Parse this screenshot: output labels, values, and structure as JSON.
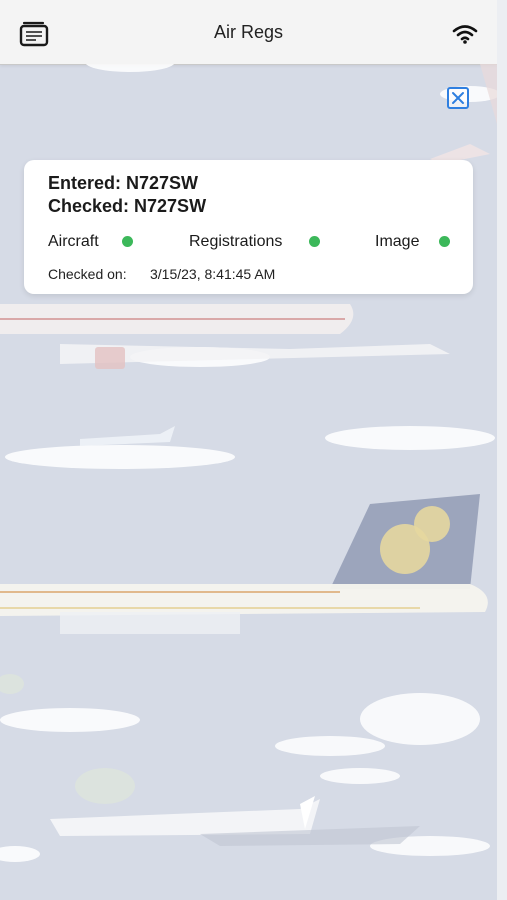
{
  "app": {
    "title": "Air Regs",
    "menu_icon": "document-stack-icon",
    "wifi_icon": "wifi-icon",
    "close_icon": "close-icon"
  },
  "result": {
    "entered": "Entered: N727SW",
    "checked": "Checked: N727SW",
    "statuses": [
      {
        "label": "Aircraft",
        "state": "green"
      },
      {
        "label": "Registrations",
        "state": "green"
      },
      {
        "label": "Image",
        "state": "green"
      }
    ],
    "checked_on_label": "Checked on:",
    "checked_on_value": "3/15/23, 8:41:45 AM"
  },
  "colors": {
    "status_ok": "#3cb85a",
    "accent": "#2f7fe0",
    "background": "#d6dbe6"
  }
}
